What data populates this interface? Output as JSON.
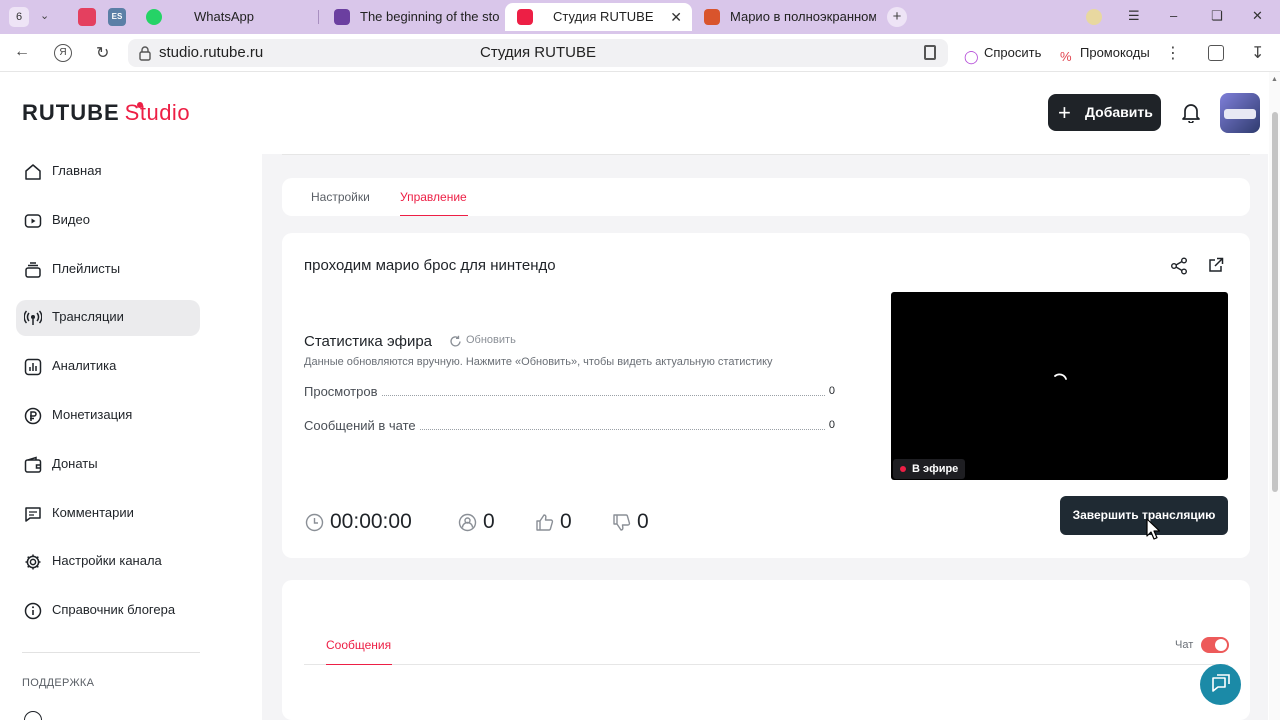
{
  "browser": {
    "tab_count": "6",
    "tabs": [
      {
        "label": "WhatsApp"
      },
      {
        "label": "The beginning of the story"
      },
      {
        "label": "Студия RUTUBE"
      },
      {
        "label": "Марио в полноэкранном"
      }
    ],
    "url": "studio.rutube.ru",
    "page_title": "Студия RUTUBE",
    "ask_label": "Спросить",
    "promo_label": "Промокоды"
  },
  "header": {
    "logo_main": "RUTUBE",
    "logo_sub": "Studio",
    "add_label": "Добавить"
  },
  "sidebar": {
    "items": [
      {
        "label": "Главная",
        "icon": "home-icon"
      },
      {
        "label": "Видео",
        "icon": "video-icon"
      },
      {
        "label": "Плейлисты",
        "icon": "playlist-icon"
      },
      {
        "label": "Трансляции",
        "icon": "broadcast-icon"
      },
      {
        "label": "Аналитика",
        "icon": "analytics-icon"
      },
      {
        "label": "Монетизация",
        "icon": "ruble-icon"
      },
      {
        "label": "Донаты",
        "icon": "wallet-icon"
      },
      {
        "label": "Комментарии",
        "icon": "comment-icon"
      },
      {
        "label": "Настройки канала",
        "icon": "gear-icon"
      },
      {
        "label": "Справочник блогера",
        "icon": "info-icon"
      }
    ],
    "active_index": 3,
    "support_title": "ПОДДЕРЖКА"
  },
  "main": {
    "tabs": [
      {
        "label": "Настройки"
      },
      {
        "label": "Управление"
      }
    ],
    "active_tab": 1,
    "stream": {
      "title": "проходим марио брос для нинтендо",
      "stats_title": "Статистика эфира",
      "refresh_label": "Обновить",
      "stats_note": "Данные обновляются вручную. Нажмите «Обновить», чтобы видеть актуальную статистику",
      "rows": [
        {
          "label": "Просмотров",
          "value": "0"
        },
        {
          "label": "Сообщений в чате",
          "value": "0"
        }
      ],
      "duration": "00:00:00",
      "viewers": "0",
      "likes": "0",
      "dislikes": "0",
      "live_label": "В эфире",
      "end_button": "Завершить трансляцию"
    },
    "chat": {
      "tab_label": "Сообщения",
      "toggle_label": "Чат",
      "toggle_on": true
    }
  },
  "colors": {
    "accent": "#ed1f45",
    "dark_button": "#1f2328",
    "help_button": "#1b8aa7"
  }
}
